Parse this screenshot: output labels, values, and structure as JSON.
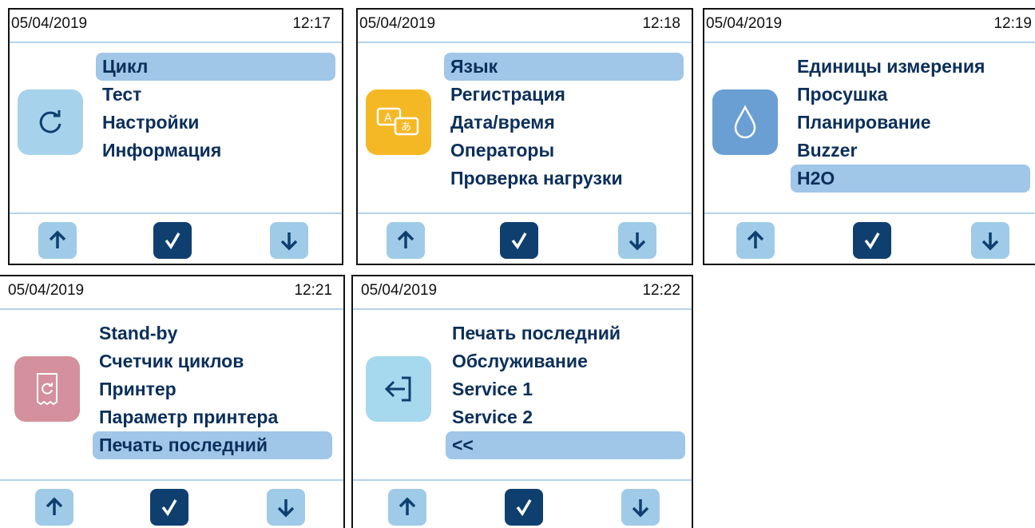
{
  "screens": [
    {
      "date": "05/04/2019",
      "time": "12:17",
      "icon": "refresh-icon",
      "icon_color": "#a6d2ec",
      "items": [
        "Цикл",
        "Тест",
        "Настройки",
        "Информация"
      ],
      "selected": 0
    },
    {
      "date": "05/04/2019",
      "time": "12:18",
      "icon": "language-icon",
      "icon_color": "#f5b825",
      "items": [
        "Язык",
        "Регистрация",
        "Дата/время",
        "Операторы",
        "Проверка нагрузки"
      ],
      "selected": 0
    },
    {
      "date": "05/04/2019",
      "time": "12:19",
      "icon": "water-drop-icon",
      "icon_color": "#6a9fd4",
      "items": [
        "Единицы измерения",
        "Просушка",
        "Планирование",
        "Buzzer",
        "H2O"
      ],
      "selected": 4
    },
    {
      "date": "05/04/2019",
      "time": "12:21",
      "icon": "printer-icon",
      "icon_color": "#d4909c",
      "items": [
        "Stand-by",
        "Счетчик циклов",
        "Принтер",
        "Параметр принтера",
        "Печать последний"
      ],
      "selected": 4
    },
    {
      "date": "05/04/2019",
      "time": "12:22",
      "icon": "exit-icon",
      "icon_color": "#a6d8ee",
      "items": [
        "Печать последний",
        "Обслуживание",
        "Service 1",
        "Service 2",
        "<<"
      ],
      "selected": 4
    }
  ],
  "colors": {
    "selected_row": "#a0c6e8",
    "arrow_button": "#9fcbe8",
    "confirm_button": "#0f3f6f",
    "divider": "#b5d2ea",
    "menu_text": "#0b2f5a"
  }
}
